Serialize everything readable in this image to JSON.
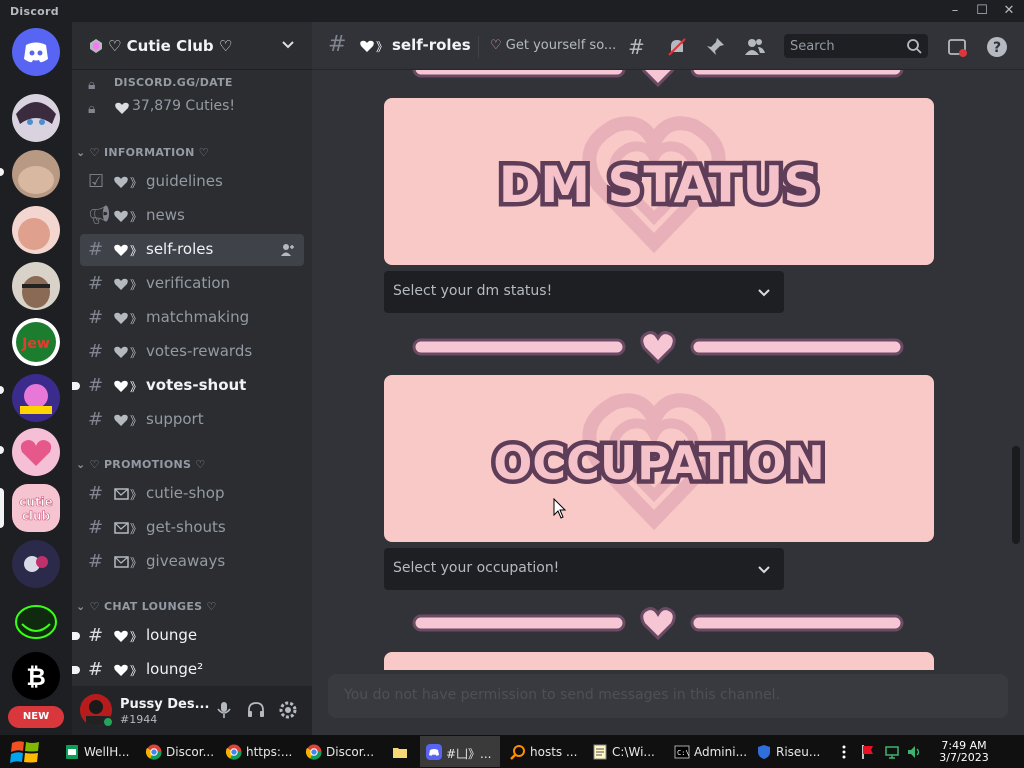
{
  "window": {
    "app_name": "Discord",
    "controls": [
      "minimize",
      "maximize",
      "close"
    ]
  },
  "servers": [
    {
      "name": "direct-messages",
      "color": "#5865f2"
    },
    {
      "name": "server-anime-avatar",
      "color": "#7a6e7a"
    },
    {
      "name": "server-photo-1",
      "color": "#c9a58f"
    },
    {
      "name": "server-photo-2",
      "color": "#e4b5a8"
    },
    {
      "name": "server-photo-3",
      "color": "#8a6a55"
    },
    {
      "name": "server-mountain-jew",
      "color": "#1d7d2f"
    },
    {
      "name": "server-kitten-paradise",
      "color": "#3b2b8c"
    },
    {
      "name": "server-heart",
      "color": "#e6578a"
    },
    {
      "name": "server-cutie-club",
      "color": "#f6c3d1"
    },
    {
      "name": "server-dark-moon",
      "color": "#2c2a4a"
    },
    {
      "name": "server-trollface",
      "color": "#0f2a0f"
    },
    {
      "name": "server-bitcoin",
      "color": "#000000"
    }
  ],
  "new_badge": "NEW",
  "guild": {
    "name": "♡ Cutie Club ♡"
  },
  "sidebar": {
    "pinned": [
      {
        "label": "DISCORD.GG/DATE"
      },
      {
        "label": "37,879 Cuties!"
      }
    ],
    "categories": [
      {
        "name": "♡ INFORMATION ♡",
        "channels": [
          {
            "name": "guidelines",
            "icon": "rules-icon"
          },
          {
            "name": "news",
            "icon": "announcement-icon"
          },
          {
            "name": "self-roles",
            "icon": "hash-icon",
            "active": true
          },
          {
            "name": "verification",
            "icon": "hash-icon"
          },
          {
            "name": "matchmaking",
            "icon": "hash-icon"
          },
          {
            "name": "votes-rewards",
            "icon": "hash-icon"
          },
          {
            "name": "votes-shout",
            "icon": "hash-icon",
            "unread": true
          },
          {
            "name": "support",
            "icon": "hash-icon"
          }
        ]
      },
      {
        "name": "♡ PROMOTIONS ♡",
        "channels": [
          {
            "name": "cutie-shop",
            "icon": "hash-icon"
          },
          {
            "name": "get-shouts",
            "icon": "hash-icon"
          },
          {
            "name": "giveaways",
            "icon": "hash-icon"
          }
        ]
      },
      {
        "name": "♡ CHAT LOUNGES ♡",
        "channels": [
          {
            "name": "lounge",
            "icon": "hash-icon",
            "unread": true
          },
          {
            "name": "lounge²",
            "icon": "hash-icon"
          }
        ]
      }
    ]
  },
  "user": {
    "name": "Pussy Des...",
    "tag": "#1944",
    "status": "online"
  },
  "channel_header": {
    "name": "self-roles",
    "topic": "Get yourself so...",
    "search_placeholder": "Search"
  },
  "content": {
    "banners": [
      {
        "title": "DM STATUS"
      },
      {
        "title": "OCCUPATION"
      }
    ],
    "selects": [
      {
        "placeholder": "Select your dm status!"
      },
      {
        "placeholder": "Select your occupation!"
      }
    ],
    "composer_text": "You do not have permission to send messages in this channel."
  },
  "colors": {
    "banner_bg": "#f9c9c7",
    "banner_text": "#5e3d58",
    "divider_pink": "#f7c6d4",
    "divider_outline": "#6b4a63",
    "accent": "#5865f2"
  },
  "taskbar": {
    "items": [
      {
        "label": "WellH...",
        "icon": "sheets-icon"
      },
      {
        "label": "Discor...",
        "icon": "chrome-icon"
      },
      {
        "label": "https:...",
        "icon": "chrome-icon"
      },
      {
        "label": "Discor...",
        "icon": "chrome-icon"
      },
      {
        "label": "",
        "icon": "folder-icon"
      },
      {
        "label": "#凵》...",
        "icon": "discord-icon",
        "active": true
      },
      {
        "label": "hosts ...",
        "icon": "search-icon"
      },
      {
        "label": "C:\\Wi...",
        "icon": "notepad-icon"
      },
      {
        "label": "Admini...",
        "icon": "cmd-icon"
      },
      {
        "label": "Riseu...",
        "icon": "shield-icon"
      }
    ],
    "clock": {
      "time": "7:49 AM",
      "date": "3/7/2023"
    }
  }
}
